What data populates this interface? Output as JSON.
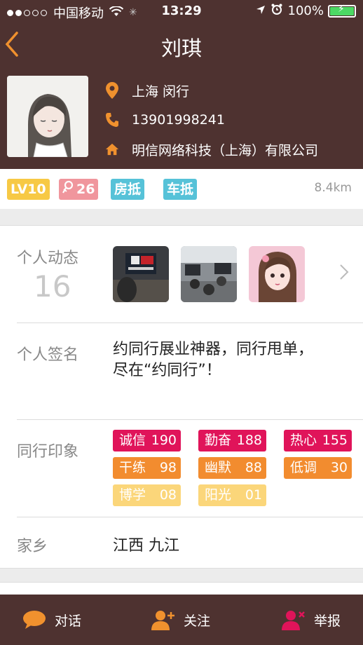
{
  "status": {
    "carrier": "中国移动",
    "time": "13:29",
    "battery": "100%",
    "battery_level": 1.0,
    "signal_bars": 2,
    "signal_total": 5
  },
  "nav": {
    "title": "刘琪",
    "back_icon": "chevron-left-icon"
  },
  "profile": {
    "location": "上海 闵行",
    "phone": "13901998241",
    "company": "明信网络科技（上海）有限公司"
  },
  "tags": {
    "level": "LV10",
    "flowers": "26",
    "mortgage_house": "房抵",
    "mortgage_car": "车抵",
    "distance": "8.4km"
  },
  "sections": {
    "posts_label": "个人动态",
    "posts_count": "16",
    "signature_label": "个人签名",
    "signature_line1": "约同行展业神器，同行甩单，",
    "signature_line2": "尽在“约同行”！",
    "impression_label": "同行印象",
    "hometown_label": "家乡",
    "hometown": "江西 九江"
  },
  "impressions": [
    {
      "name": "诚信",
      "count": "190",
      "color": "#e0145a"
    },
    {
      "name": "勤奋",
      "count": "188",
      "color": "#e0145a"
    },
    {
      "name": "热心",
      "count": "155",
      "color": "#e0145a"
    },
    {
      "name": "干练",
      "count": "98",
      "color": "#f28c2f"
    },
    {
      "name": "幽默",
      "count": "88",
      "color": "#f28c2f"
    },
    {
      "name": "低调",
      "count": "30",
      "color": "#f28c2f"
    },
    {
      "name": "博学",
      "count": "08",
      "color": "#fbd67a"
    },
    {
      "name": "阳光",
      "count": "01",
      "color": "#fbd67a"
    }
  ],
  "footer": {
    "chat": "对话",
    "follow": "关注",
    "report": "举报"
  },
  "colors": {
    "brown": "#4e3230",
    "accent_orange": "#f0912e",
    "level_yellow": "#f7c945",
    "flower_pink": "#f0969d",
    "tag_blue": "#56c2d8"
  }
}
